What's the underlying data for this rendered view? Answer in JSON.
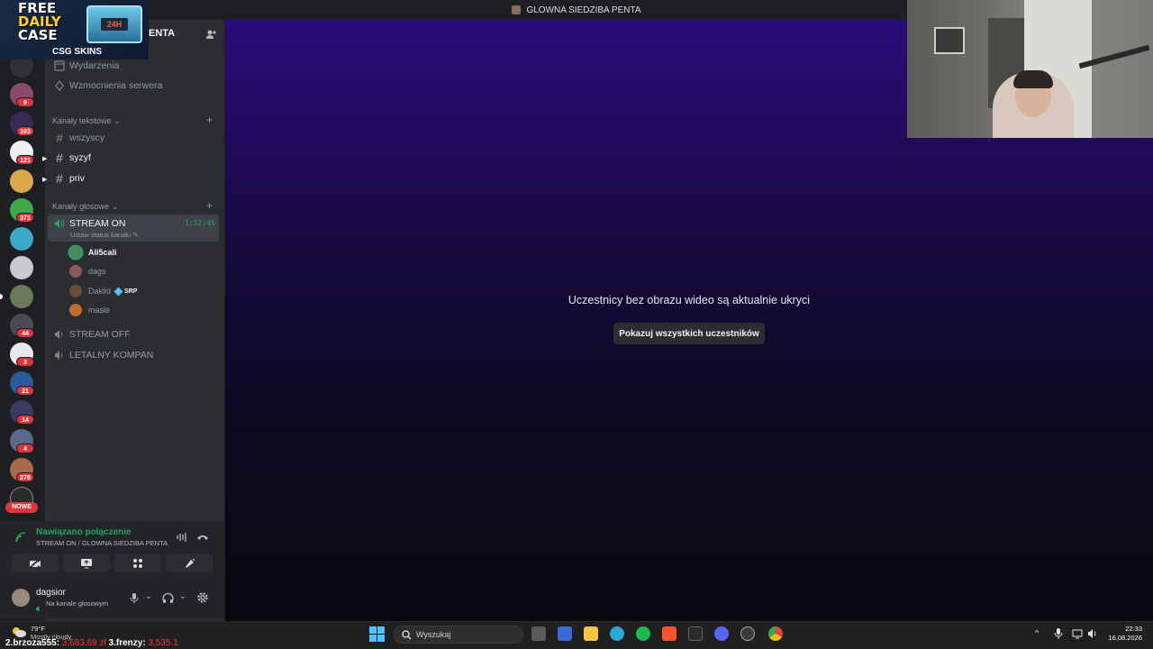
{
  "window": {
    "title": "GLOWNA SIEDZIBA PENTA"
  },
  "promo": {
    "line1": "FREE",
    "line2": "DAILY",
    "line3": "CASE",
    "brand": "CSG SKINS",
    "box_label": "24H"
  },
  "server": {
    "name_visible": "ENTA"
  },
  "sidebar": {
    "top_items": [
      {
        "label": "Wydarzenia"
      },
      {
        "label": "Wzmocnienia serwera"
      }
    ],
    "text_category": "Kanały tekstowe",
    "text_channels": [
      {
        "label": "wszyscy"
      },
      {
        "label": "syzyf"
      },
      {
        "label": "priv"
      }
    ],
    "voice_category": "Kanały głosowe",
    "active_voice": {
      "label": "STREAM ON",
      "time": "1:52:45",
      "status": "Ustaw status kanału"
    },
    "voice_users": [
      {
        "name": "Ali5cali",
        "speaking": true,
        "color": "#4b8a5e"
      },
      {
        "name": "dags",
        "speaking": false,
        "color": "#8a5a5a"
      },
      {
        "name": "Daklid",
        "speaking": false,
        "color": "#6a4a3a",
        "badge": "SRP"
      },
      {
        "name": "masle",
        "speaking": false,
        "color": "#c26a2a"
      }
    ],
    "other_voice": [
      {
        "label": "STREAM OFF"
      },
      {
        "label": "LETALNY KOMPAN"
      }
    ]
  },
  "rail": {
    "badges": [
      "9",
      "103",
      "121",
      "371",
      "44",
      "3",
      "21",
      "14",
      "4",
      "278"
    ],
    "new_label": "NOWE"
  },
  "voice_panel": {
    "status": "Nawiązano połączenie",
    "sub": "STREAM ON / GLOWNA SIEDZIBA PENTA"
  },
  "user_panel": {
    "name": "dagsior",
    "sub": "Na kanale głosowym"
  },
  "main": {
    "message": "Uczestnicy bez obrazu wideo są aktualnie ukryci",
    "button": "Pokazuj wszystkich uczestników"
  },
  "taskbar": {
    "weather_temp": "79°F",
    "weather_desc": "Mostly cloudy",
    "ticker_a": "2.brzoza555:",
    "ticker_a_val": "3,683.69 zł",
    "ticker_b": "3.frenzy:",
    "ticker_b_val": "3,535.1",
    "search_placeholder": "Wyszukaj",
    "time": "22:33",
    "date": "16.08.2026"
  },
  "colors": {
    "accent_green": "#23a55a",
    "badge_red": "#da373c",
    "stage_top": "#2a0d7a"
  }
}
